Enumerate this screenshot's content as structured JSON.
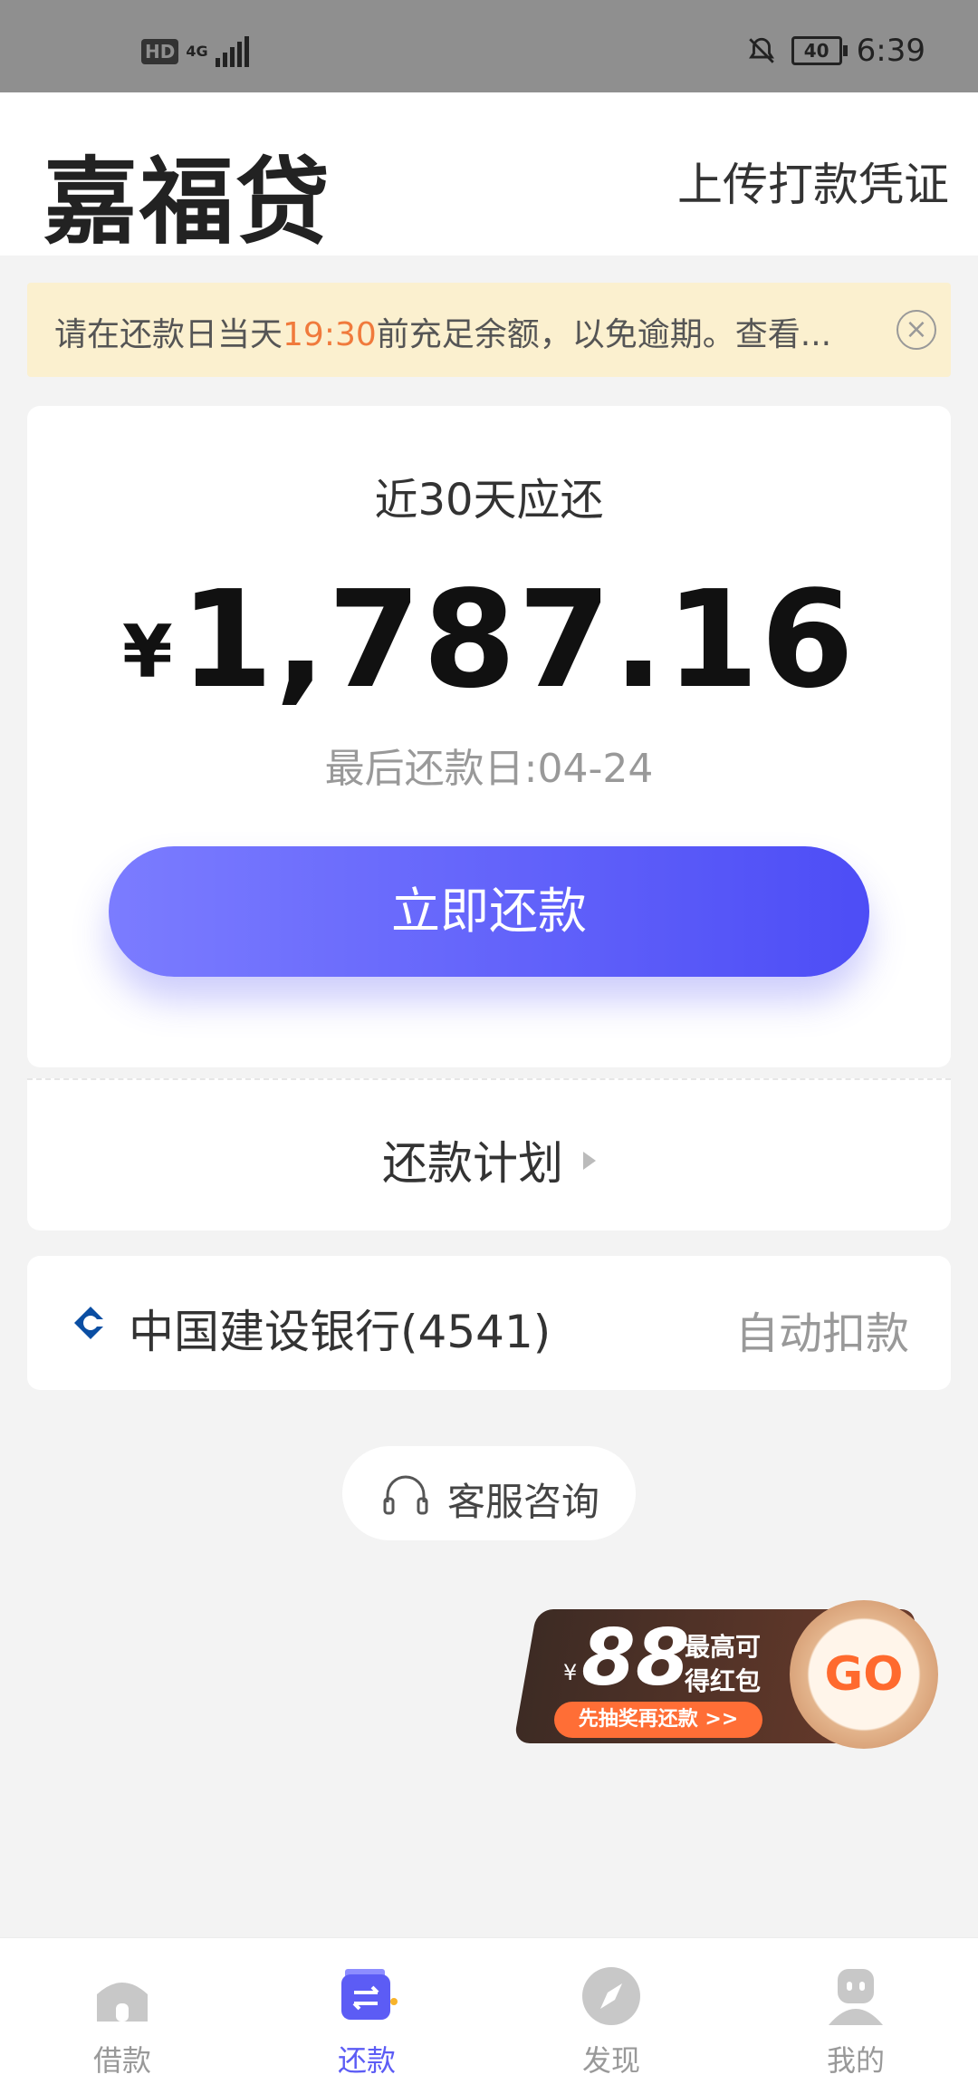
{
  "status_bar": {
    "hd": "HD",
    "network": "4G",
    "battery": "40",
    "time": "6:39"
  },
  "header": {
    "app_title": "嘉福贷",
    "upload_link": "上传打款凭证"
  },
  "notice": {
    "text_before": "请在还款日当天",
    "highlight": "19:30",
    "text_after": "前充足余额，以免逾期。查看...",
    "close": "×",
    "highlight_color": "#f07a3c"
  },
  "repayment": {
    "due_label": "近30天应还",
    "currency": "¥",
    "amount": "1,787.16",
    "last_date": "最后还款日:04-24",
    "repay_button": "立即还款",
    "plan_link": "还款计划"
  },
  "bank": {
    "name": "中国建设银行(4541)",
    "mode": "自动扣款",
    "icon": "ccb-bank-icon"
  },
  "support": {
    "label": "客服咨询",
    "icon": "headset-icon"
  },
  "promo": {
    "yen": "¥",
    "amount": "88",
    "line1": "最高可",
    "line2": "得红包",
    "pill": "先抽奖再还款 >>",
    "go": "GO"
  },
  "tabs": [
    {
      "label": "借款",
      "icon": "home-icon",
      "active": false
    },
    {
      "label": "还款",
      "icon": "wallet-exchange-icon",
      "active": true
    },
    {
      "label": "发现",
      "icon": "compass-icon",
      "active": false
    },
    {
      "label": "我的",
      "icon": "profile-icon",
      "active": false
    }
  ],
  "colors": {
    "accent": "#5c5cf5",
    "notice_bg": "#fbf0cf",
    "button_gradient": [
      "#7b7cff",
      "#4d4df6"
    ]
  }
}
